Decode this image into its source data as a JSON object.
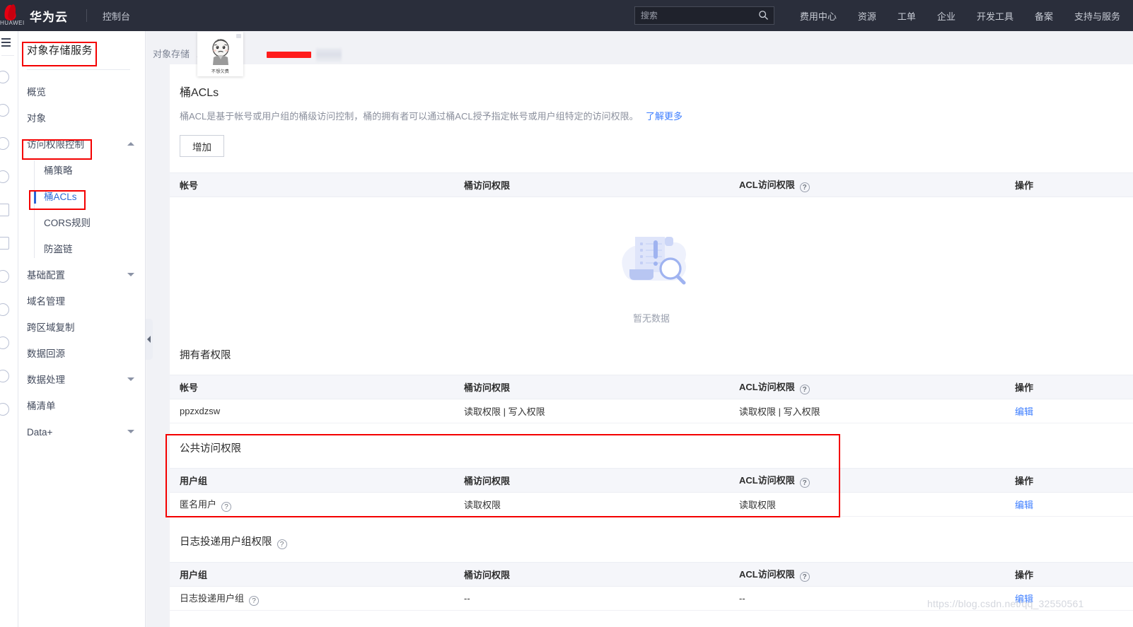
{
  "topbar": {
    "brand": "华为云",
    "brand_sub": "HUAWEI",
    "console": "控制台",
    "search": {
      "placeholder": "搜索",
      "value": "",
      "icon": "search-icon"
    },
    "nav": [
      {
        "label": "费用中心"
      },
      {
        "label": "资源"
      },
      {
        "label": "工单"
      },
      {
        "label": "企业"
      },
      {
        "label": "开发工具"
      },
      {
        "label": "备案"
      },
      {
        "label": "支持与服务"
      }
    ]
  },
  "sidebar": {
    "service_title": "对象存储服务",
    "items": [
      {
        "label": "概览",
        "type": "link"
      },
      {
        "label": "对象",
        "type": "link"
      },
      {
        "label": "访问权限控制",
        "type": "group",
        "caret": "chevron-up-icon",
        "expanded": true
      },
      {
        "label": "基础配置",
        "type": "group",
        "caret": "chevron-down-icon",
        "expanded": false
      },
      {
        "label": "域名管理",
        "type": "link"
      },
      {
        "label": "跨区域复制",
        "type": "link"
      },
      {
        "label": "数据回源",
        "type": "link"
      },
      {
        "label": "数据处理",
        "type": "group",
        "caret": "chevron-down-icon",
        "expanded": false
      },
      {
        "label": "桶清单",
        "type": "link"
      },
      {
        "label": "Data+",
        "type": "group",
        "caret": "chevron-down-icon",
        "expanded": false
      }
    ],
    "sub_items": [
      {
        "label": "桶策略",
        "active": false
      },
      {
        "label": "桶ACLs",
        "active": true
      },
      {
        "label": "CORS规则",
        "active": false
      },
      {
        "label": "防盗链",
        "active": false
      }
    ]
  },
  "breadcrumb": {
    "root": "对象存储",
    "separator": "/"
  },
  "sticker": {
    "label": "不想欠费"
  },
  "page": {
    "title": "桶ACLs",
    "description": "桶ACL是基于帐号或用户组的桶级访问控制，桶的拥有者可以通过桶ACL授予指定帐号或用户组特定的访问权限。",
    "learn_more": "了解更多",
    "add_button": "增加"
  },
  "acl_table": {
    "headers": [
      "帐号",
      "桶访问权限",
      "ACL访问权限",
      "操作"
    ],
    "help_on_header_index": 2,
    "rows": [],
    "empty_text": "暂无数据"
  },
  "owner_section": {
    "title": "拥有者权限",
    "headers": [
      "帐号",
      "桶访问权限",
      "ACL访问权限",
      "操作"
    ],
    "rows": [
      {
        "account": "ppzxdzsw",
        "bucket_perm": "读取权限 | 写入权限",
        "acl_perm": "读取权限 | 写入权限",
        "action": "编辑"
      }
    ]
  },
  "public_section": {
    "title": "公共访问权限",
    "headers": [
      "用户组",
      "桶访问权限",
      "ACL访问权限",
      "操作"
    ],
    "rows": [
      {
        "group": "匿名用户",
        "group_help": true,
        "bucket_perm": "读取权限",
        "acl_perm": "读取权限",
        "action": "编辑"
      }
    ]
  },
  "log_section": {
    "title": "日志投递用户组权限",
    "title_help": true,
    "headers": [
      "用户组",
      "桶访问权限",
      "ACL访问权限",
      "操作"
    ],
    "rows": [
      {
        "group": "日志投递用户组",
        "group_help": true,
        "bucket_perm": "--",
        "acl_perm": "--",
        "action": "编辑"
      }
    ]
  },
  "watermark": "https://blog.csdn.net/qq_32550561",
  "colors": {
    "topbar_bg": "#2a2e3b",
    "accent_link": "#3d7eff",
    "annotation_red": "#f40000",
    "brand_red": "#e60012",
    "page_bg": "#f1f2f6",
    "table_header_bg": "#f5f6fa"
  }
}
